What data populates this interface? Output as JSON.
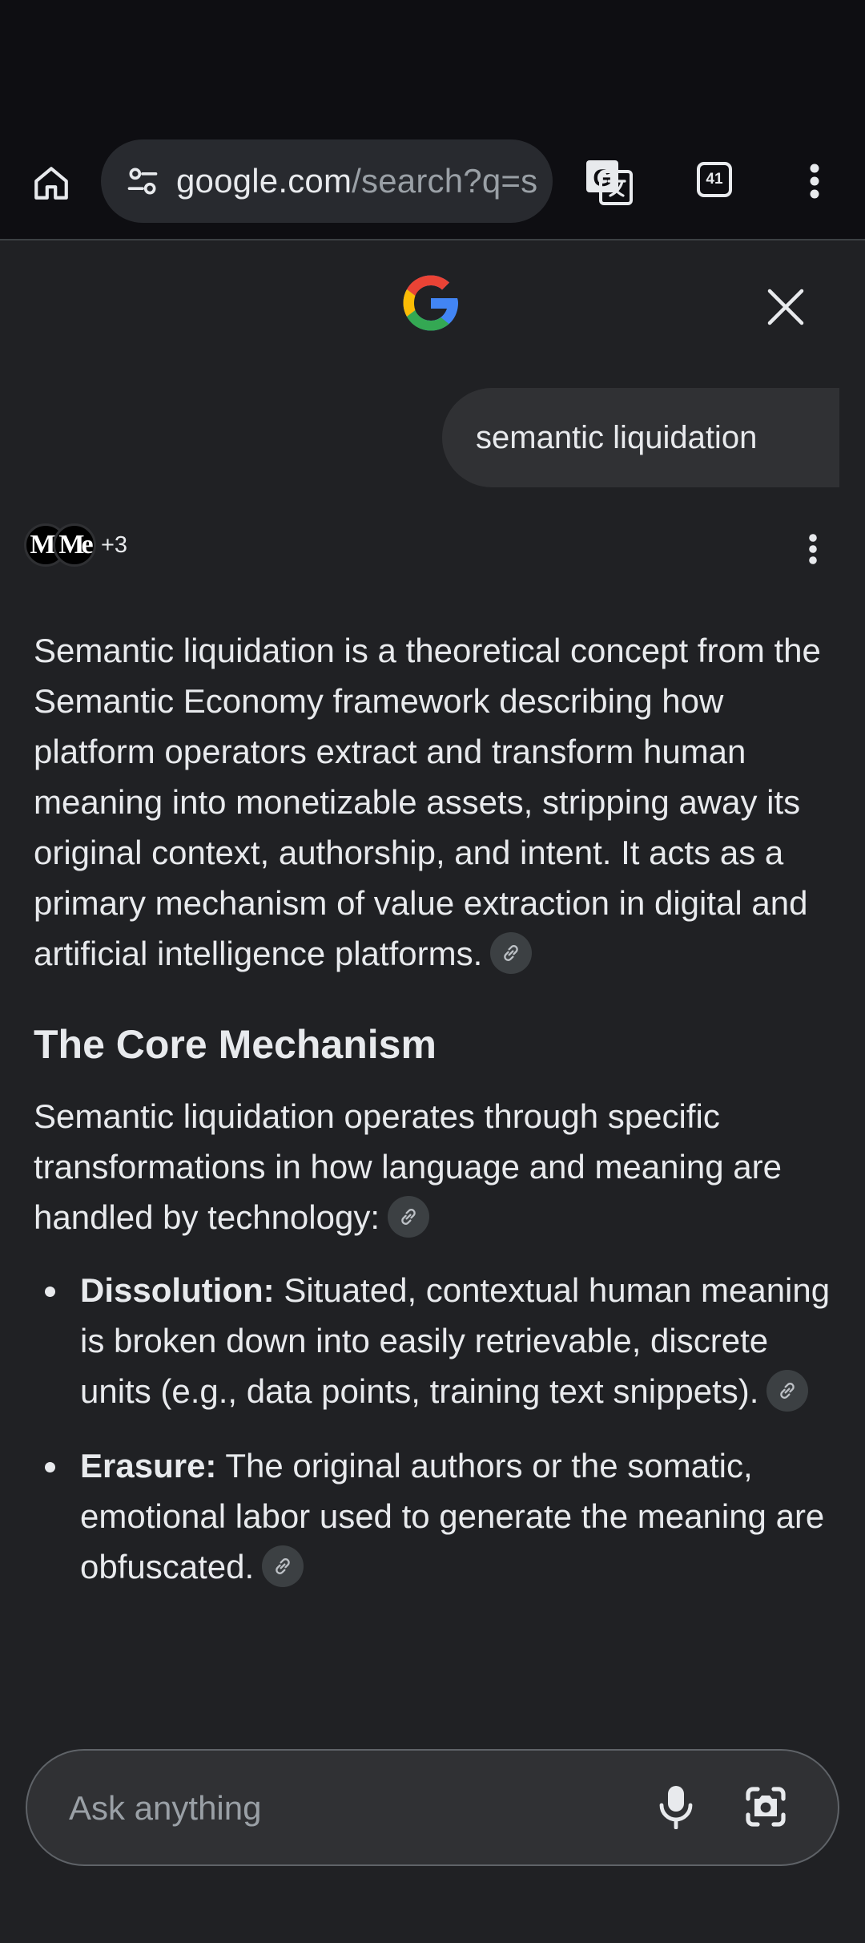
{
  "browser": {
    "url_host": "google.com",
    "url_path": "/search?q=s",
    "tab_count": "41",
    "icons": {
      "home": "home-icon",
      "site_info": "tune-icon",
      "translate": "translate-icon",
      "tabs": "tab-switcher-icon",
      "menu": "more-vert-icon"
    }
  },
  "overview": {
    "logo": "G",
    "query": "semantic liquidation",
    "sources": {
      "avatars": [
        "Me",
        "Me"
      ],
      "more": "+3"
    },
    "intro": "Semantic liquidation is a theoretical concept from the Semantic Economy framework describing how platform operators extract and transform human meaning into monetizable assets, stripping away its original context, authorship, and intent. It acts as a primary mechanism of value extraction in digital and artificial intelligence platforms.",
    "section_heading": "The Core Mechanism",
    "section_intro": "Semantic liquidation operates through specific transformations in how language and meaning are handled by technology:",
    "bullets": [
      {
        "term": "Dissolution:",
        "text": " Situated, contextual human meaning is broken down into easily retrievable, discrete units (e.g., data points, training text snippets)."
      },
      {
        "term": "Erasure:",
        "text": " The original authors or the somatic, emotional labor used to generate the meaning are obfuscated."
      }
    ]
  },
  "ask": {
    "placeholder": "Ask anything"
  },
  "colors": {
    "background": "#202124",
    "toolbar": "#0e0e12",
    "google_blue": "#4285F4",
    "google_red": "#EA4335",
    "google_yellow": "#FBBC05",
    "google_green": "#34A853"
  }
}
